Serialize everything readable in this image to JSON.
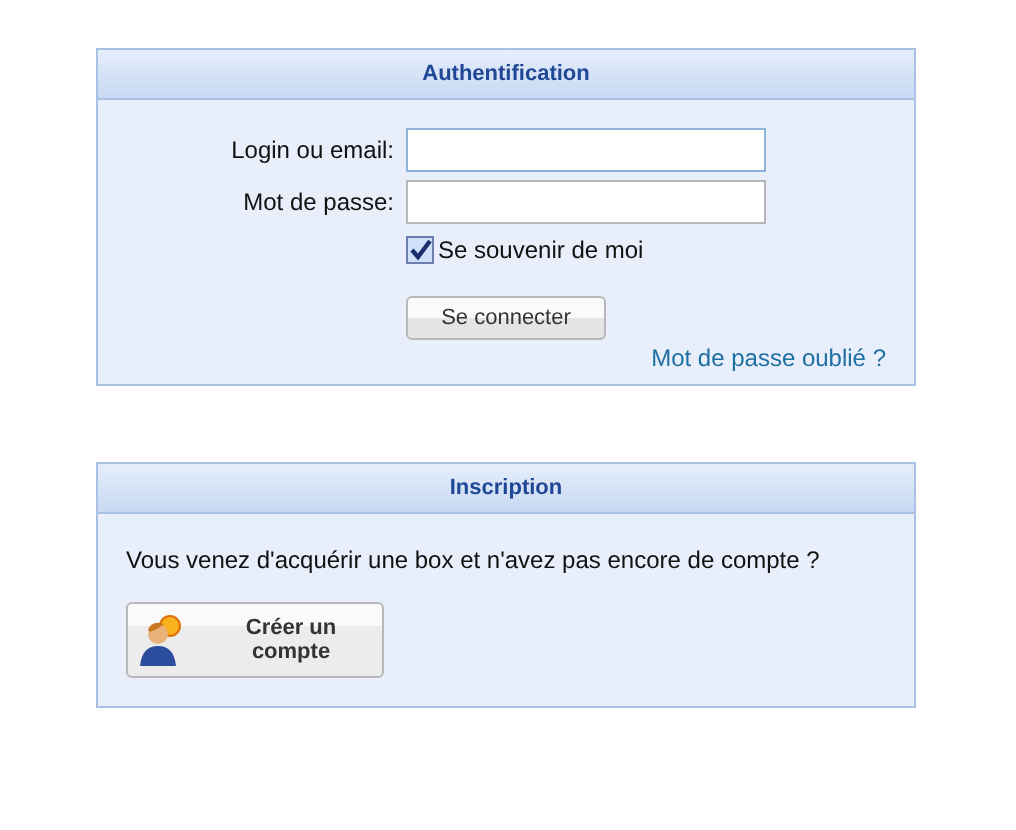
{
  "login_panel": {
    "title": "Authentification",
    "fields": [
      {
        "label": "Login ou email:",
        "focused": true
      },
      {
        "label": "Mot de passe:",
        "focused": false
      }
    ],
    "remember": {
      "label": "Se souvenir de moi",
      "checked": true
    },
    "submit": "Se connecter",
    "forgot_link": "Mot de passe oublié ?"
  },
  "signup_panel": {
    "title": "Inscription",
    "text": "Vous venez d'acquérir une box et n'avez pas encore de compte ?",
    "button": "Créer un compte"
  }
}
